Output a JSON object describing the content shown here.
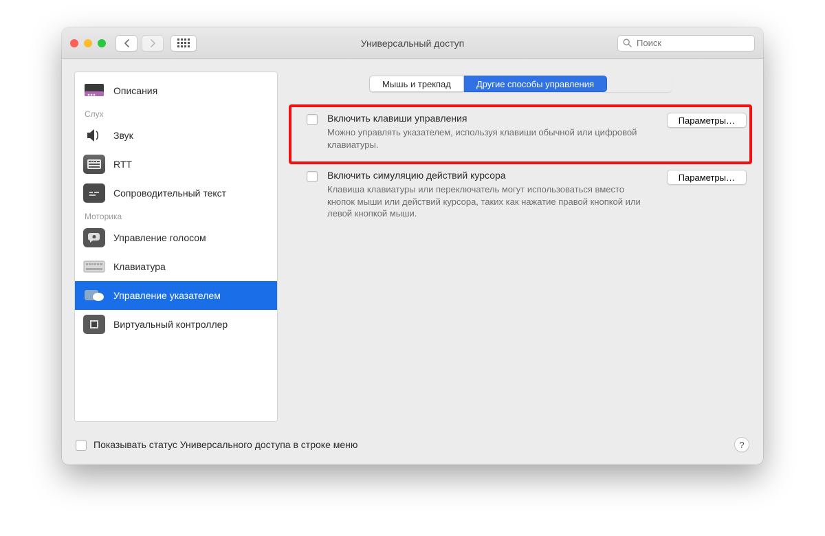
{
  "window": {
    "title": "Универсальный доступ"
  },
  "search": {
    "placeholder": "Поиск"
  },
  "sidebar": {
    "items": [
      {
        "label": "Описания"
      }
    ],
    "group_hearing": "Слух",
    "hearing": [
      {
        "label": "Звук"
      },
      {
        "label": "RTT"
      },
      {
        "label": "Сопроводительный текст"
      }
    ],
    "group_motor": "Моторика",
    "motor": [
      {
        "label": "Управление голосом"
      },
      {
        "label": "Клавиатура"
      },
      {
        "label": "Управление указателем"
      },
      {
        "label": "Виртуальный контроллер"
      }
    ]
  },
  "tabs": {
    "tab1": "Мышь и трекпад",
    "tab2": "Другие способы управления"
  },
  "option1": {
    "title": "Включить клавиши управления",
    "desc": "Можно управлять указателем, используя клавиши обычной или цифровой клавиатуры.",
    "button": "Параметры…"
  },
  "option2": {
    "title": "Включить симуляцию действий курсора",
    "desc": "Клавиша клавиатуры или переключатель могут использоваться вместо кнопок мыши или действий курсора, таких как нажатие правой кнопкой или левой кнопкой мыши.",
    "button": "Параметры…"
  },
  "footer": {
    "checkbox_label": "Показывать статус Универсального доступа в строке меню"
  }
}
